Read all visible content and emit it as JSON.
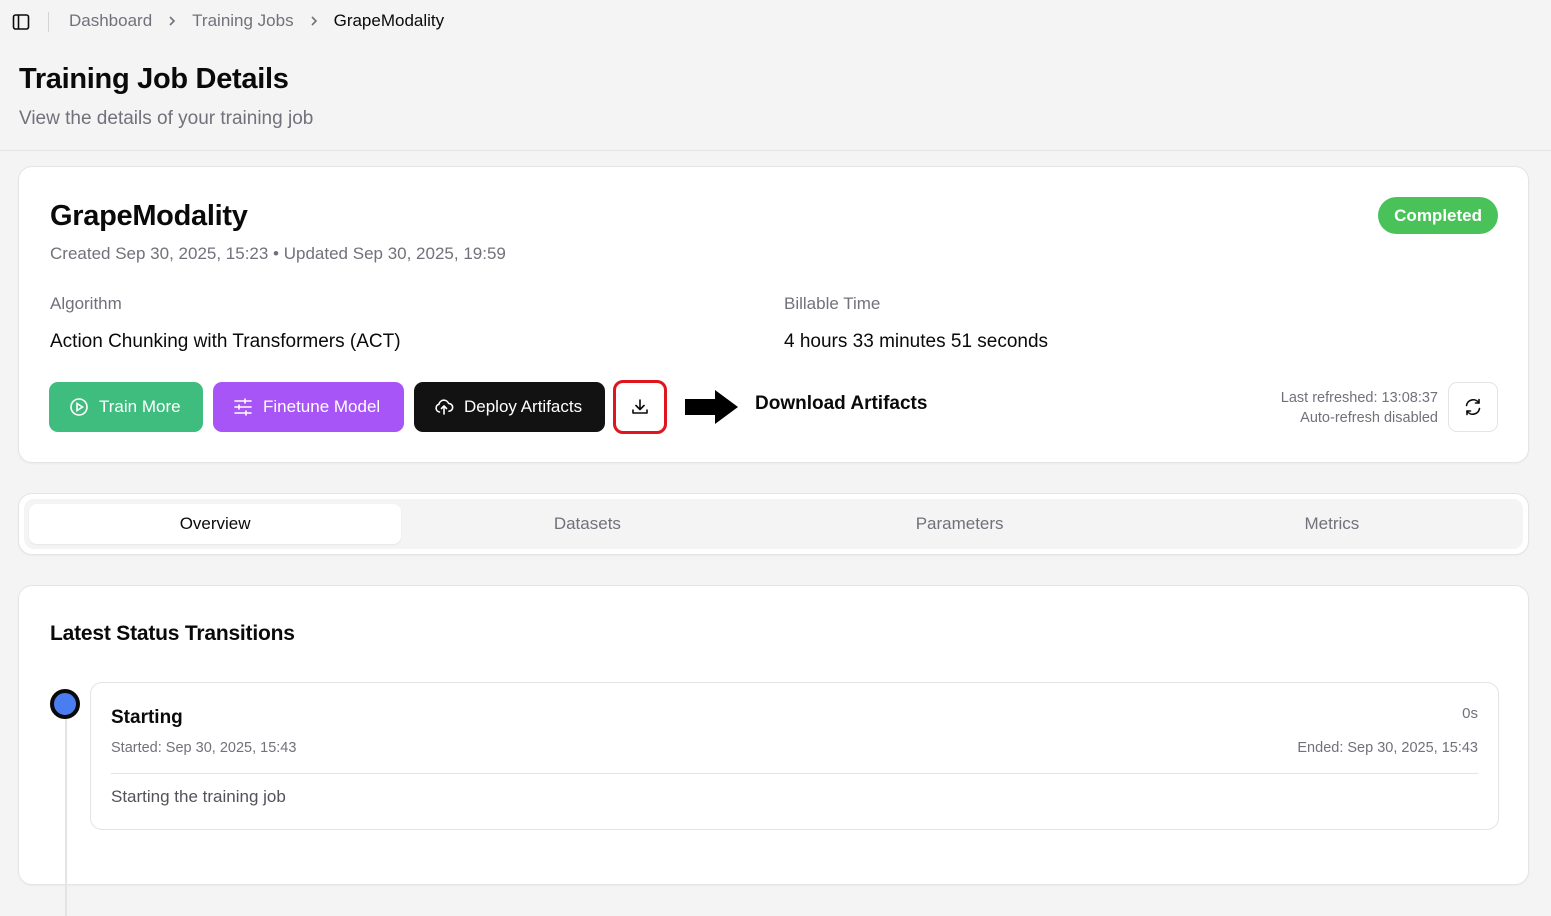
{
  "breadcrumb": {
    "items": [
      {
        "label": "Dashboard"
      },
      {
        "label": "Training Jobs"
      },
      {
        "label": "GrapeModality"
      }
    ]
  },
  "page": {
    "title": "Training Job Details",
    "subtitle": "View the details of your training job"
  },
  "job": {
    "name": "GrapeModality",
    "meta": "Created Sep 30, 2025, 15:23 • Updated Sep 30, 2025, 19:59",
    "status": "Completed",
    "algorithm_label": "Algorithm",
    "algorithm_value": "Action Chunking with Transformers (ACT)",
    "billable_label": "Billable Time",
    "billable_value": "4 hours 33 minutes 51 seconds"
  },
  "actions": {
    "train_more": "Train More",
    "finetune": "Finetune Model",
    "deploy": "Deploy Artifacts",
    "annotation": "Download Artifacts",
    "last_refreshed": "Last refreshed: 13:08:37",
    "auto_refresh": "Auto-refresh disabled"
  },
  "tabs": [
    {
      "label": "Overview",
      "active": true
    },
    {
      "label": "Datasets",
      "active": false
    },
    {
      "label": "Parameters",
      "active": false
    },
    {
      "label": "Metrics",
      "active": false
    }
  ],
  "transitions": {
    "title": "Latest Status Transitions",
    "items": [
      {
        "name": "Starting",
        "duration": "0s",
        "started": "Started: Sep 30, 2025, 15:43",
        "ended": "Ended: Sep 30, 2025, 15:43",
        "message": "Starting the training job"
      }
    ]
  },
  "colors": {
    "completed": "#4ac25a",
    "train": "#3ebd7f",
    "finetune": "#a855f7",
    "deploy": "#121212",
    "highlight": "#e0161e",
    "timeline_dot": "#4a7df0"
  },
  "icons": [
    "sidebar-toggle-icon",
    "chevron-right-icon",
    "play-circle-icon",
    "sliders-icon",
    "cloud-upload-icon",
    "download-icon",
    "arrow-right-icon",
    "refresh-icon"
  ]
}
